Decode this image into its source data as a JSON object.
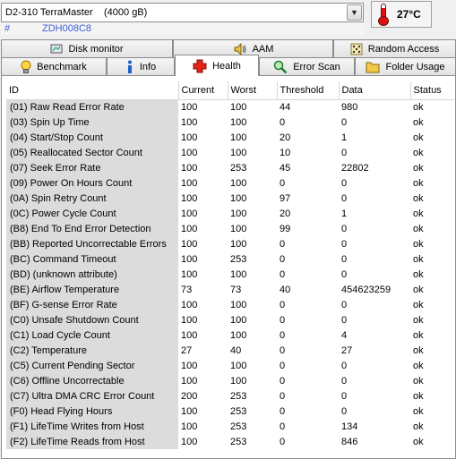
{
  "drive": {
    "model": "D2-310  TerraMaster",
    "capacity": "(4000 gB)",
    "serial_prefix": "#",
    "serial": "ZDH008C8"
  },
  "temperature": "27°C",
  "tabs_row1": [
    {
      "label": "Disk monitor",
      "icon": "disk-monitor-icon"
    },
    {
      "label": "AAM",
      "icon": "speaker-icon"
    },
    {
      "label": "Random Access",
      "icon": "random-access-icon"
    }
  ],
  "tabs_row2": [
    {
      "label": "Benchmark",
      "icon": "lightbulb-icon"
    },
    {
      "label": "Info",
      "icon": "info-icon"
    },
    {
      "label": "Health",
      "icon": "health-cross-icon",
      "active": true
    },
    {
      "label": "Error Scan",
      "icon": "magnifier-icon"
    },
    {
      "label": "Folder Usage",
      "icon": "folder-icon"
    }
  ],
  "columns": [
    "ID",
    "Current",
    "Worst",
    "Threshold",
    "Data",
    "Status"
  ],
  "rows": [
    [
      "(01) Raw Read Error Rate",
      "100",
      "100",
      "44",
      "980",
      "ok"
    ],
    [
      "(03) Spin Up Time",
      "100",
      "100",
      "0",
      "0",
      "ok"
    ],
    [
      "(04) Start/Stop Count",
      "100",
      "100",
      "20",
      "1",
      "ok"
    ],
    [
      "(05) Reallocated Sector Count",
      "100",
      "100",
      "10",
      "0",
      "ok"
    ],
    [
      "(07) Seek Error Rate",
      "100",
      "253",
      "45",
      "22802",
      "ok"
    ],
    [
      "(09) Power On Hours Count",
      "100",
      "100",
      "0",
      "0",
      "ok"
    ],
    [
      "(0A) Spin Retry Count",
      "100",
      "100",
      "97",
      "0",
      "ok"
    ],
    [
      "(0C) Power Cycle Count",
      "100",
      "100",
      "20",
      "1",
      "ok"
    ],
    [
      "(B8) End To End Error Detection",
      "100",
      "100",
      "99",
      "0",
      "ok"
    ],
    [
      "(BB) Reported Uncorrectable Errors",
      "100",
      "100",
      "0",
      "0",
      "ok"
    ],
    [
      "(BC) Command Timeout",
      "100",
      "253",
      "0",
      "0",
      "ok"
    ],
    [
      "(BD) (unknown attribute)",
      "100",
      "100",
      "0",
      "0",
      "ok"
    ],
    [
      "(BE) Airflow Temperature",
      "73",
      "73",
      "40",
      "454623259",
      "ok"
    ],
    [
      "(BF) G-sense Error Rate",
      "100",
      "100",
      "0",
      "0",
      "ok"
    ],
    [
      "(C0) Unsafe Shutdown Count",
      "100",
      "100",
      "0",
      "0",
      "ok"
    ],
    [
      "(C1) Load Cycle Count",
      "100",
      "100",
      "0",
      "4",
      "ok"
    ],
    [
      "(C2) Temperature",
      "27",
      "40",
      "0",
      "27",
      "ok"
    ],
    [
      "(C5) Current Pending Sector",
      "100",
      "100",
      "0",
      "0",
      "ok"
    ],
    [
      "(C6) Offline Uncorrectable",
      "100",
      "100",
      "0",
      "0",
      "ok"
    ],
    [
      "(C7) Ultra DMA CRC Error Count",
      "200",
      "253",
      "0",
      "0",
      "ok"
    ],
    [
      "(F0) Head Flying Hours",
      "100",
      "253",
      "0",
      "0",
      "ok"
    ],
    [
      "(F1) LifeTime Writes from Host",
      "100",
      "253",
      "0",
      "134",
      "ok"
    ],
    [
      "(F2) LifeTime Reads from Host",
      "100",
      "253",
      "0",
      "846",
      "ok"
    ]
  ],
  "colors": {
    "serial_text": "#3d5fd6",
    "id_cell_bg": "#dcdcdc",
    "thermometer_red": "#dd1111"
  }
}
